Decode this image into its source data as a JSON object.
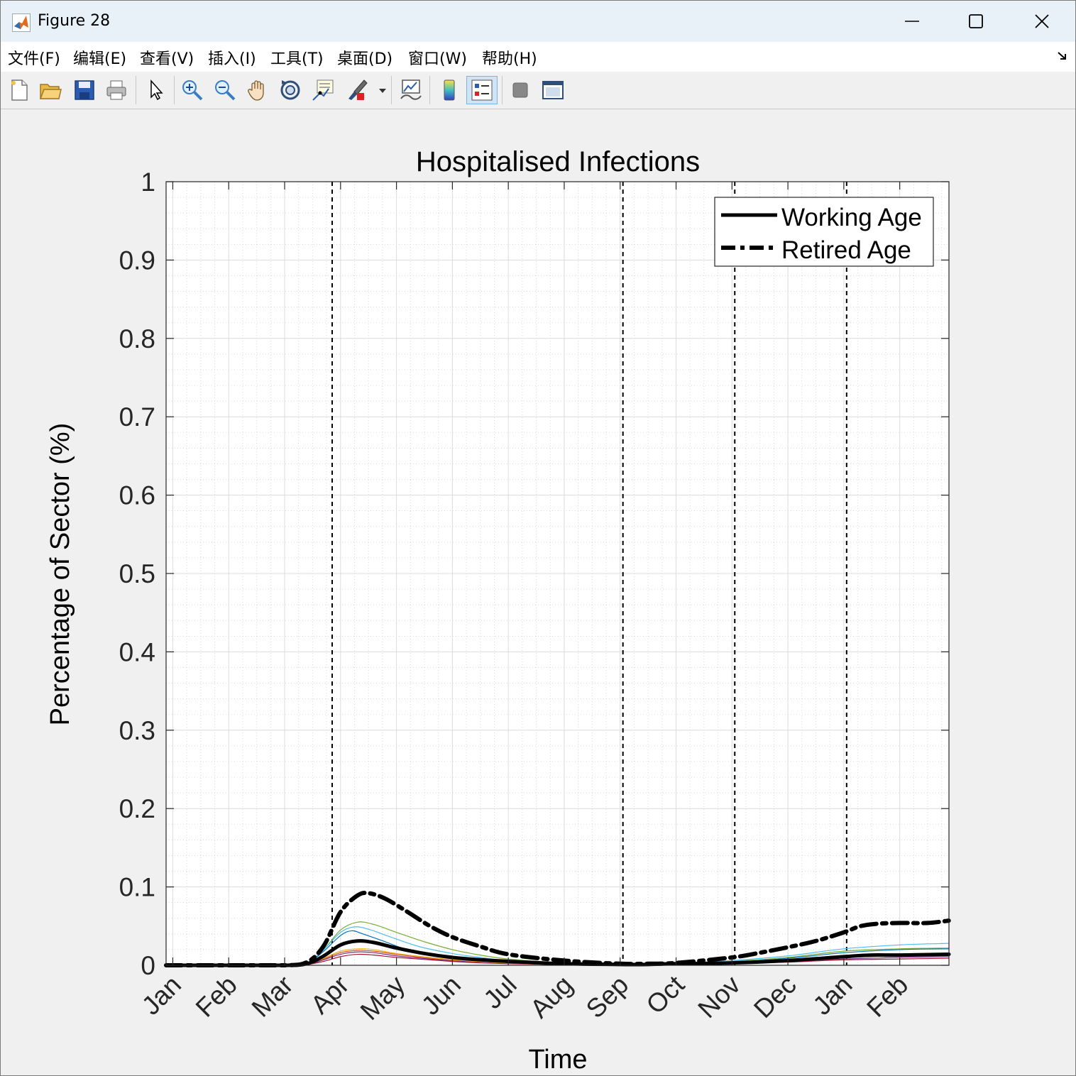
{
  "window": {
    "title": "Figure 28"
  },
  "menubar": {
    "items": [
      "文件(F)",
      "编辑(E)",
      "查看(V)",
      "插入(I)",
      "工具(T)",
      "桌面(D)",
      "窗口(W)",
      "帮助(H)"
    ]
  },
  "toolbar": {
    "buttons": [
      "new-figure-icon",
      "open-file-icon",
      "save-icon",
      "print-icon",
      "pointer-icon",
      "zoom-in-icon",
      "zoom-out-icon",
      "pan-hand-icon",
      "rotate-3d-icon",
      "data-cursor-icon",
      "brush-icon",
      "link-plot-icon",
      "colorbar-icon",
      "legend-icon",
      "hide-plot-tools-icon",
      "show-plot-tools-icon"
    ],
    "active": "legend-icon"
  },
  "chart_data": {
    "type": "line",
    "title": "Hospitalised Infections",
    "xlabel": "Time",
    "ylabel": "Percentage of Sector (%)",
    "ylim": [
      0,
      1
    ],
    "yticks": [
      "0",
      "0.1",
      "0.2",
      "0.3",
      "0.4",
      "0.5",
      "0.6",
      "0.7",
      "0.8",
      "0.9",
      "1"
    ],
    "xticks": [
      "Jan",
      "Feb",
      "Mar",
      "Apr",
      "May",
      "Jun",
      "Jul",
      "Aug",
      "Sep",
      "Oct",
      "Nov",
      "Dec",
      "Jan",
      "Feb"
    ],
    "grid": true,
    "minor_grid": true,
    "legend": {
      "position": "top-right",
      "entries": [
        "Working Age",
        "Retired Age"
      ]
    },
    "vlines_month_index": [
      2.85,
      8.05,
      10.05,
      12.05
    ],
    "series": [
      {
        "name": "Working Age",
        "style": "solid",
        "color": "#000000",
        "x": [
          0,
          1,
          2,
          2.4,
          2.7,
          3.0,
          3.3,
          3.6,
          4.0,
          4.5,
          5.0,
          5.5,
          6.0,
          7.0,
          8.0,
          8.5,
          9.0,
          10.0,
          11.0,
          12.0,
          12.5,
          13.0,
          14.0
        ],
        "y": [
          0,
          0,
          0,
          0.002,
          0.012,
          0.026,
          0.031,
          0.029,
          0.022,
          0.015,
          0.01,
          0.007,
          0.005,
          0.002,
          0.001,
          0.001,
          0.002,
          0.003,
          0.006,
          0.011,
          0.013,
          0.013,
          0.014
        ]
      },
      {
        "name": "Retired Age",
        "style": "dashed",
        "color": "#000000",
        "x": [
          0,
          1,
          2,
          2.4,
          2.7,
          3.0,
          3.3,
          3.5,
          3.8,
          4.2,
          4.6,
          5.0,
          5.5,
          6.0,
          7.0,
          8.0,
          8.5,
          9.0,
          10.0,
          10.5,
          11.0,
          11.5,
          12.0,
          12.3,
          12.6,
          13.0,
          13.5,
          14.0
        ],
        "y": [
          0,
          0,
          0,
          0.004,
          0.025,
          0.068,
          0.089,
          0.092,
          0.085,
          0.068,
          0.05,
          0.036,
          0.024,
          0.014,
          0.006,
          0.002,
          0.002,
          0.003,
          0.01,
          0.016,
          0.023,
          0.031,
          0.042,
          0.05,
          0.053,
          0.054,
          0.054,
          0.057
        ]
      },
      {
        "style": "thin",
        "color": "#77ac30",
        "x": [
          0,
          2,
          2.4,
          2.7,
          3.0,
          3.3,
          3.6,
          4.0,
          4.5,
          5.0,
          5.5,
          6.0,
          7.0,
          8.0,
          9.0,
          10.0,
          11.0,
          12.0,
          13.0,
          14.0
        ],
        "y": [
          0,
          0,
          0.003,
          0.02,
          0.045,
          0.055,
          0.052,
          0.042,
          0.03,
          0.02,
          0.013,
          0.008,
          0.003,
          0.001,
          0.002,
          0.005,
          0.01,
          0.018,
          0.021,
          0.022
        ]
      },
      {
        "style": "thin",
        "color": "#4dbeee",
        "x": [
          0,
          2,
          2.4,
          2.7,
          3.0,
          3.25,
          3.5,
          3.9,
          4.4,
          5.0,
          5.5,
          6.0,
          7.0,
          8.0,
          9.0,
          10.0,
          11.0,
          12.0,
          13.0,
          14.0
        ],
        "y": [
          0,
          0,
          0.003,
          0.02,
          0.042,
          0.049,
          0.046,
          0.036,
          0.024,
          0.015,
          0.01,
          0.006,
          0.002,
          0.001,
          0.002,
          0.006,
          0.012,
          0.021,
          0.026,
          0.028
        ]
      },
      {
        "style": "thin",
        "color": "#0072bd",
        "x": [
          0,
          2,
          2.4,
          2.7,
          3.0,
          3.2,
          3.4,
          3.8,
          4.2,
          4.8,
          5.5,
          6.0,
          7.0,
          8.0,
          9.0,
          10.0,
          11.0,
          12.0,
          13.0,
          14.0
        ],
        "y": [
          0,
          0,
          0.003,
          0.018,
          0.038,
          0.044,
          0.04,
          0.03,
          0.02,
          0.012,
          0.007,
          0.004,
          0.002,
          0.001,
          0.002,
          0.004,
          0.009,
          0.016,
          0.02,
          0.021
        ]
      },
      {
        "style": "thin",
        "color": "#d95319",
        "x": [
          0,
          2,
          2.4,
          2.7,
          3.0,
          3.3,
          3.6,
          4.0,
          4.6,
          5.2,
          6.0,
          7.0,
          8.0,
          9.0,
          10.0,
          11.0,
          12.0,
          13.0,
          14.0
        ],
        "y": [
          0,
          0,
          0.001,
          0.008,
          0.016,
          0.019,
          0.018,
          0.014,
          0.009,
          0.006,
          0.003,
          0.001,
          0.0005,
          0.001,
          0.003,
          0.006,
          0.01,
          0.012,
          0.013
        ]
      },
      {
        "style": "thin",
        "color": "#7e2f8e",
        "x": [
          0,
          2,
          2.4,
          2.7,
          3.0,
          3.3,
          3.6,
          4.0,
          4.6,
          5.2,
          6.0,
          7.0,
          8.0,
          9.0,
          10.0,
          11.0,
          12.0,
          13.0,
          14.0
        ],
        "y": [
          0,
          0,
          0.001,
          0.007,
          0.014,
          0.017,
          0.016,
          0.012,
          0.008,
          0.005,
          0.003,
          0.001,
          0.0005,
          0.001,
          0.002,
          0.005,
          0.008,
          0.01,
          0.011
        ]
      },
      {
        "style": "thin",
        "color": "#a2142f",
        "x": [
          0,
          2,
          2.4,
          2.7,
          3.0,
          3.3,
          3.6,
          4.0,
          4.6,
          5.2,
          6.0,
          7.0,
          8.0,
          9.0,
          10.0,
          11.0,
          12.0,
          13.0,
          14.0
        ],
        "y": [
          0,
          0,
          0.001,
          0.005,
          0.011,
          0.014,
          0.013,
          0.01,
          0.007,
          0.004,
          0.002,
          0.001,
          0.0005,
          0.001,
          0.002,
          0.004,
          0.007,
          0.008,
          0.009
        ]
      },
      {
        "style": "thin",
        "color": "#edb120",
        "x": [
          0,
          2,
          2.4,
          2.7,
          3.0,
          3.3,
          3.6,
          4.0,
          4.6,
          5.2,
          6.0,
          7.0,
          8.0,
          9.0,
          10.0,
          11.0,
          12.0,
          13.0,
          14.0
        ],
        "y": [
          0,
          0,
          0.001,
          0.009,
          0.018,
          0.021,
          0.02,
          0.015,
          0.01,
          0.006,
          0.003,
          0.001,
          0.0005,
          0.001,
          0.003,
          0.006,
          0.011,
          0.014,
          0.015
        ]
      }
    ]
  }
}
